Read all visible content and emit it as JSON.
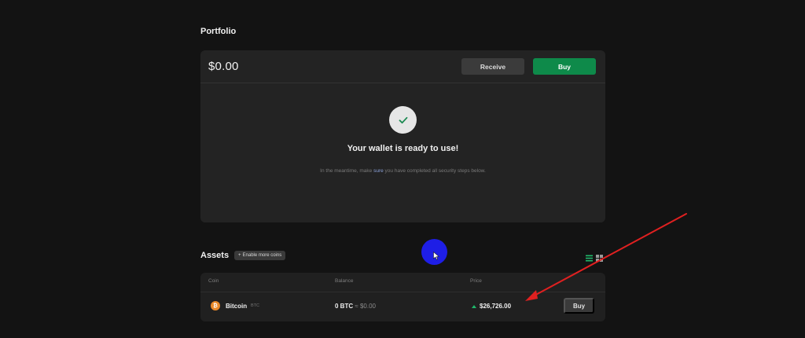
{
  "portfolio": {
    "title": "Portfolio",
    "balance": "$0.00",
    "receive_label": "Receive",
    "buy_label": "Buy",
    "ready_message": "Your wallet is ready to use!",
    "hint_prefix": "In the meantime, make ",
    "hint_link": "sure",
    "hint_suffix": " you have completed all security steps below."
  },
  "assets": {
    "title": "Assets",
    "enable_label": "Enable more coins",
    "columns": {
      "coin": "Coin",
      "balance": "Balance",
      "price": "Price"
    },
    "rows": [
      {
        "icon_letter": "₿",
        "name": "Bitcoin",
        "symbol": "BTC",
        "balance_crypto": "0 BTC",
        "balance_fiat": "≈ $0.00",
        "price": "$26,726.00",
        "buy_label": "Buy"
      }
    ]
  },
  "colors": {
    "accent_green": "#0e8a4a",
    "price_up": "#1fb86a",
    "bitcoin_orange": "#e8892a",
    "annotation_red": "#e02020",
    "cursor_highlight": "#1e1ee6"
  },
  "icons": {
    "check": "check-icon",
    "plus": "plus-icon",
    "list_view": "list-view-icon",
    "grid_view": "grid-view-icon",
    "bitcoin": "bitcoin-icon",
    "price_trend": "trend-up-icon"
  }
}
